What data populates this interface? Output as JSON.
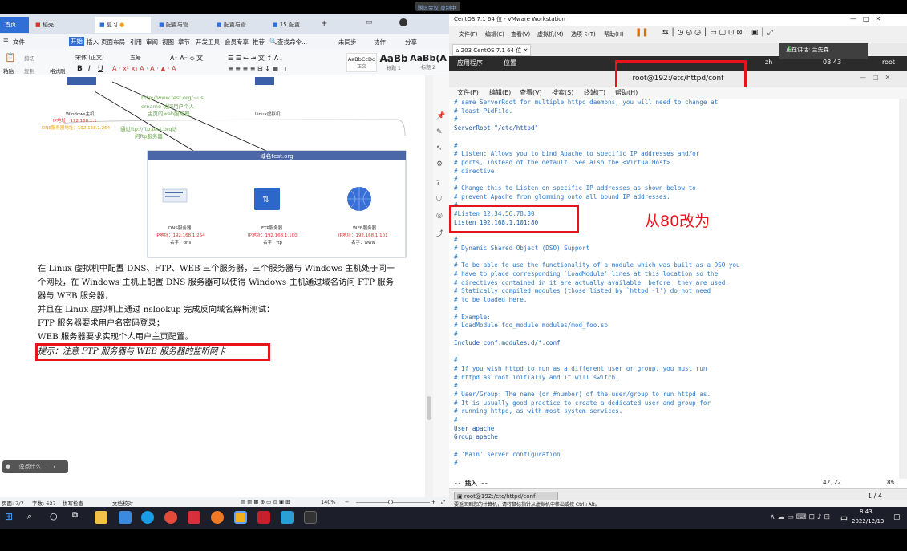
{
  "meeting": {
    "label": "腾讯会议",
    "share": "录制中"
  },
  "wps": {
    "tabs": {
      "home": "首页",
      "t1": "稻壳",
      "t2": "复习",
      "t3": "配置与管",
      "t4": "配置与管",
      "t5": "15 配置"
    },
    "menu": {
      "file": "文件",
      "start": "开始",
      "insert": "插入",
      "layout": "页面布局",
      "ref": "引用",
      "review": "审阅",
      "view": "视图",
      "chapter": "章节",
      "dev": "开发工具",
      "member": "会员专享",
      "recommend": "推荐",
      "search": "查找命令...",
      "sync": "未同步",
      "collab": "协作",
      "share": "分享"
    },
    "toolbar": {
      "paste": "粘贴",
      "cut": "剪切",
      "copy": "复制",
      "format_painter": "格式刷",
      "font": "宋体 (正文)",
      "size": "五号",
      "style_normal": "正文",
      "style_h1": "标题 1",
      "style_h2": "标题 2",
      "style_sample1": "AaBbCcDd",
      "style_sample2": "AaBb",
      "style_sample3": "AaBb(A"
    },
    "diagram": {
      "windows_host": "Windows主机",
      "windows_ip": "IP地址：192.168.1.1",
      "windows_dns": "DNS服务器地址：192.168.1.254",
      "linux_vm": "Linux虚拟机",
      "url1": "http://www.test.org/~us",
      "url1b": "ername 访问用户个人",
      "url1c": "主页的web服务器",
      "url2": "通过ftp://ftp.test.org访",
      "url2b": "问ftp服务器",
      "domain": "域名test.org",
      "dns_title": "DNS服务器",
      "dns_ip": "IP地址：192.168.1.254",
      "dns_name": "名字：dns",
      "ftp_title": "FTP服务器",
      "ftp_ip": "IP地址：192.168.1.100",
      "ftp_name": "名字：ftp",
      "web_title": "WEB服务器",
      "web_ip": "IP地址：192.168.1.101",
      "web_name": "名字：www"
    },
    "paragraphs": [
      "在 Linux 虚拟机中配置 DNS、FTP、WEB 三个服务器，三个服务器与 Windows 主机处于同一",
      "个网段，在 Windows 主机上配置 DNS 服务器可以使得 Windows 主机通过域名访问 FTP 服务",
      "器与 WEB 服务器，",
      "并且在 Linux 虚拟机上通过 nslookup 完成反向域名解析测试：",
      "FTP 服务器要求用户名密码登录；",
      "WEB 服务器要求实现个人用户主页配置。",
      "提示：注意 FTP 服务器与 WEB 服务器的监听网卡"
    ],
    "chat_placeholder": "说点什么...",
    "status": {
      "page": "页面: 7/7",
      "words": "字数: 637",
      "spell": "拼写检查",
      "proof": "文档校对",
      "zoom": "140%"
    }
  },
  "vmware": {
    "title": "CentOS 7.1 64 位 - VMware Workstation",
    "menu": {
      "file": "文件(F)",
      "edit": "编辑(E)",
      "view": "查看(V)",
      "vm": "虚拟机(M)",
      "tabs": "选项卡(T)",
      "help": "帮助(H)"
    },
    "vm_tab": "203 CentOS 7.1 64 位",
    "gnome": {
      "apps": "应用程序",
      "places": "位置",
      "lang": "zh",
      "time": "08:43",
      "user": "root",
      "speaking": "正在讲话: 兰先森"
    },
    "term_title": "root@192:/etc/httpd/conf",
    "term_menu": {
      "file": "文件(F)",
      "edit": "编辑(E)",
      "view": "查看(V)",
      "search": "搜索(S)",
      "terminal": "终端(T)",
      "help": "帮助(H)"
    },
    "lines": [
      "# same ServerRoot for multiple httpd daemons, you will need to change at",
      "# least PidFile.",
      "#",
      "ServerRoot \"/etc/httpd\"",
      "",
      "#",
      "# Listen: Allows you to bind Apache to specific IP addresses and/or",
      "# ports, instead of the default. See also the <VirtualHost>",
      "# directive.",
      "#",
      "# Change this to Listen on specific IP addresses as shown below to",
      "# prevent Apache from glomming onto all bound IP addresses.",
      "#",
      "#Listen 12.34.56.78:80",
      "Listen 192.168.1.101:80",
      "",
      "#",
      "# Dynamic Shared Object (DSO) Support",
      "#",
      "# To be able to use the functionality of a module which was built as a DSO you",
      "# have to place corresponding `LoadModule' lines at this location so the",
      "# directives contained in it are actually available _before_ they are used.",
      "# Statically compiled modules (those listed by `httpd -l') do not need",
      "# to be loaded here.",
      "#",
      "# Example:",
      "# LoadModule foo_module modules/mod_foo.so",
      "#",
      "Include conf.modules.d/*.conf",
      "",
      "#",
      "# If you wish httpd to run as a different user or group, you must run",
      "# httpd as root initially and it will switch.",
      "#",
      "# User/Group: The name (or #number) of the user/group to run httpd as.",
      "# It is usually good practice to create a dedicated user and group for",
      "# running httpd, as with most system services.",
      "#",
      "User apache",
      "Group apache",
      "",
      "# 'Main' server configuration",
      "#"
    ],
    "status_mode": "-- 插入 --",
    "status_pos": "42,22",
    "status_pct": "8%",
    "annotation": "从80改为",
    "task_item": "root@192:/etc/httpd/conf",
    "task_page": "1 / 4",
    "hint": "要返回到您的计算机，请将鼠标指针从虚拟机中移出或按 Ctrl+Alt。"
  },
  "taskbar": {
    "time": "8:43",
    "date": "2022/12/13",
    "ime": "中"
  },
  "colors": {
    "accent": "#2f6fd6",
    "highlight_red": "#e8141b",
    "term_comment": "#2d79c7"
  }
}
